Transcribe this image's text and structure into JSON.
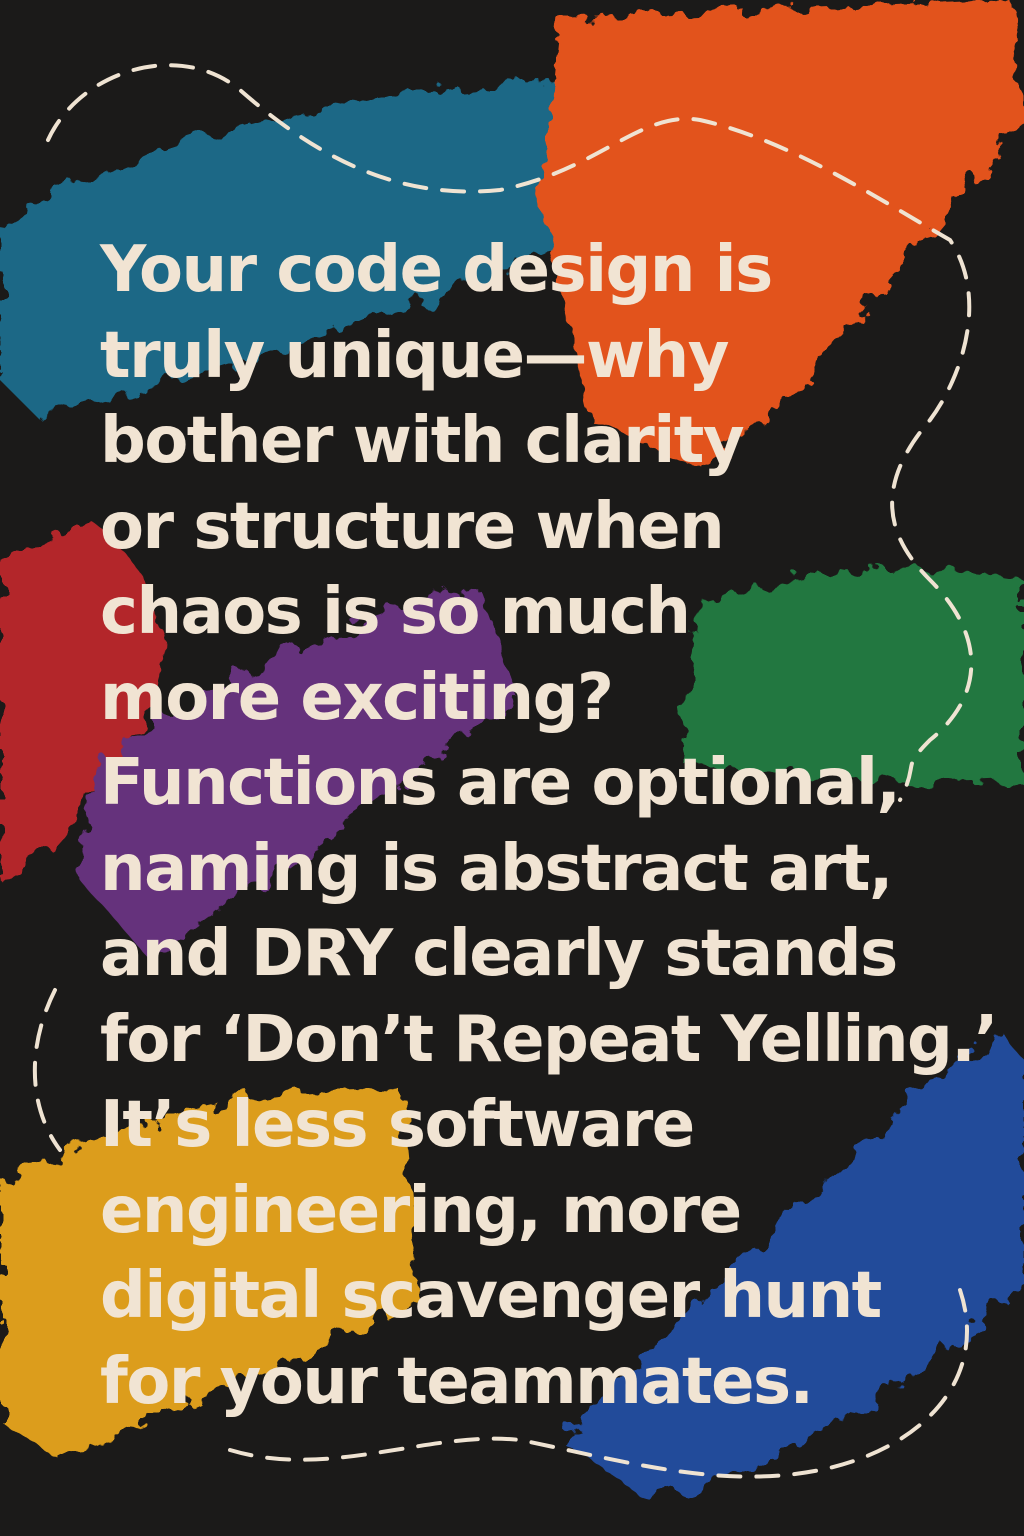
{
  "colors": {
    "background": "#1b1a19",
    "text": "#f1e4d3",
    "dashed_line": "#efe3d2",
    "strokes": {
      "teal": "#1b6886",
      "orange": "#e2521d",
      "red": "#b3272a",
      "purple": "#65307c",
      "green": "#22773f",
      "yellow": "#dc9d1f",
      "blue": "#214c9a"
    }
  },
  "quote": {
    "lines": [
      "Your code design is",
      "truly unique—why",
      "bother with clarity",
      "or structure when",
      "chaos is so much",
      "more exciting?",
      "Functions are optional,",
      "naming is abstract art,",
      "and DRY clearly stands",
      "for ‘Don’t Repeat Yelling.’",
      "It’s less software",
      "engineering, more",
      "digital scavenger  hunt",
      "for your teammates."
    ]
  }
}
